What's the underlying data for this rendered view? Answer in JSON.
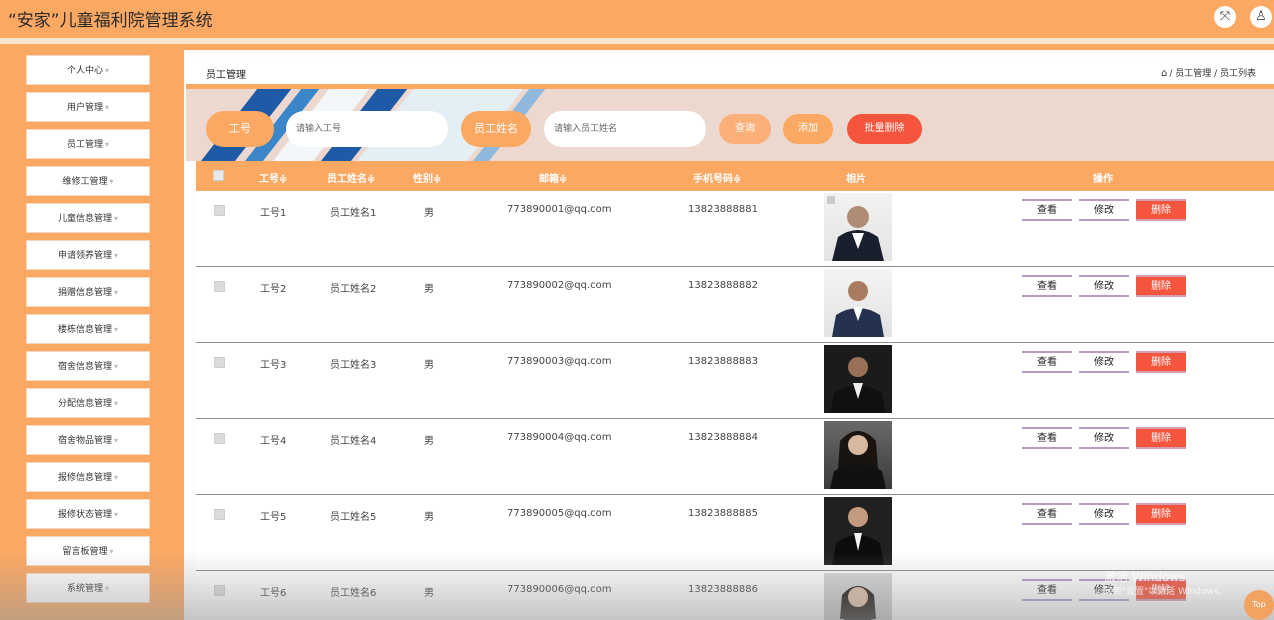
{
  "header": {
    "title": "“安家”儿童福利院管理系统",
    "fullscreen_icon": "expand-icon",
    "user_icon": "user-icon"
  },
  "sidebar": {
    "items": [
      {
        "label": "个人中心"
      },
      {
        "label": "用户管理"
      },
      {
        "label": "员工管理"
      },
      {
        "label": "维修工管理"
      },
      {
        "label": "儿童信息管理"
      },
      {
        "label": "申请领养管理"
      },
      {
        "label": "捐赠信息管理"
      },
      {
        "label": "楼栋信息管理"
      },
      {
        "label": "宿舍信息管理"
      },
      {
        "label": "分配信息管理"
      },
      {
        "label": "宿舍物品管理"
      },
      {
        "label": "报修信息管理"
      },
      {
        "label": "报修状态管理"
      },
      {
        "label": "留言板管理"
      },
      {
        "label": "系统管理"
      }
    ],
    "arrow": "▾"
  },
  "main": {
    "page_title": "员工管理",
    "breadcrumb": "/ 员工管理 / 员工列表",
    "home_icon": "⌂"
  },
  "search": {
    "id_label": "工号",
    "id_placeholder": "请输入工号",
    "name_label": "员工姓名",
    "name_placeholder": "请输入员工姓名",
    "query_label": "查询",
    "add_label": "添加",
    "batch_delete_label": "批量删除"
  },
  "table": {
    "columns": [
      "工号≑",
      "员工姓名≑",
      "性别≑",
      "邮箱≑",
      "手机号码≑",
      "相片",
      "操作"
    ],
    "rows": [
      {
        "id": "工号1",
        "name": "员工姓名1",
        "gender": "男",
        "email": "773890001@qq.com",
        "phone": "13823888881"
      },
      {
        "id": "工号2",
        "name": "员工姓名2",
        "gender": "男",
        "email": "773890002@qq.com",
        "phone": "13823888882"
      },
      {
        "id": "工号3",
        "name": "员工姓名3",
        "gender": "男",
        "email": "773890003@qq.com",
        "phone": "13823888883"
      },
      {
        "id": "工号4",
        "name": "员工姓名4",
        "gender": "男",
        "email": "773890004@qq.com",
        "phone": "13823888884"
      },
      {
        "id": "工号5",
        "name": "员工姓名5",
        "gender": "男",
        "email": "773890005@qq.com",
        "phone": "13823888885"
      },
      {
        "id": "工号6",
        "name": "员工姓名6",
        "gender": "男",
        "email": "773890006@qq.com",
        "phone": "13823888886"
      }
    ],
    "actions": {
      "view": "查看",
      "edit": "修改",
      "delete": "删除"
    }
  },
  "overlay": {
    "watermark_line1": "激活 Windows",
    "watermark_line2": "转到\"设置\"以激活 Windows。",
    "top_button": "Top"
  },
  "colors": {
    "accent": "#fba863",
    "delete": "#f5543d",
    "batch_delete": "#f5543d"
  }
}
